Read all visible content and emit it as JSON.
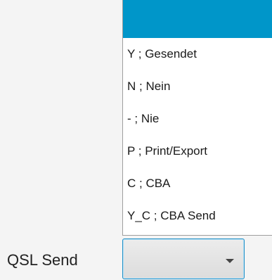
{
  "field": {
    "label": "QSL Send",
    "current_value": ""
  },
  "dropdown": {
    "selected_index": 0,
    "options": [
      {
        "label": ""
      },
      {
        "label": "Y ; Gesendet"
      },
      {
        "label": "N ; Nein"
      },
      {
        "label": "- ; Nie"
      },
      {
        "label": "P ; Print/Export"
      },
      {
        "label": "C ; CBA"
      },
      {
        "label": "Y_C ; CBA Send"
      }
    ]
  },
  "colors": {
    "selection": "#0096c9",
    "focus_border": "#1e8fc6"
  },
  "icons": {
    "combo_arrow": "chevron-down-icon"
  }
}
